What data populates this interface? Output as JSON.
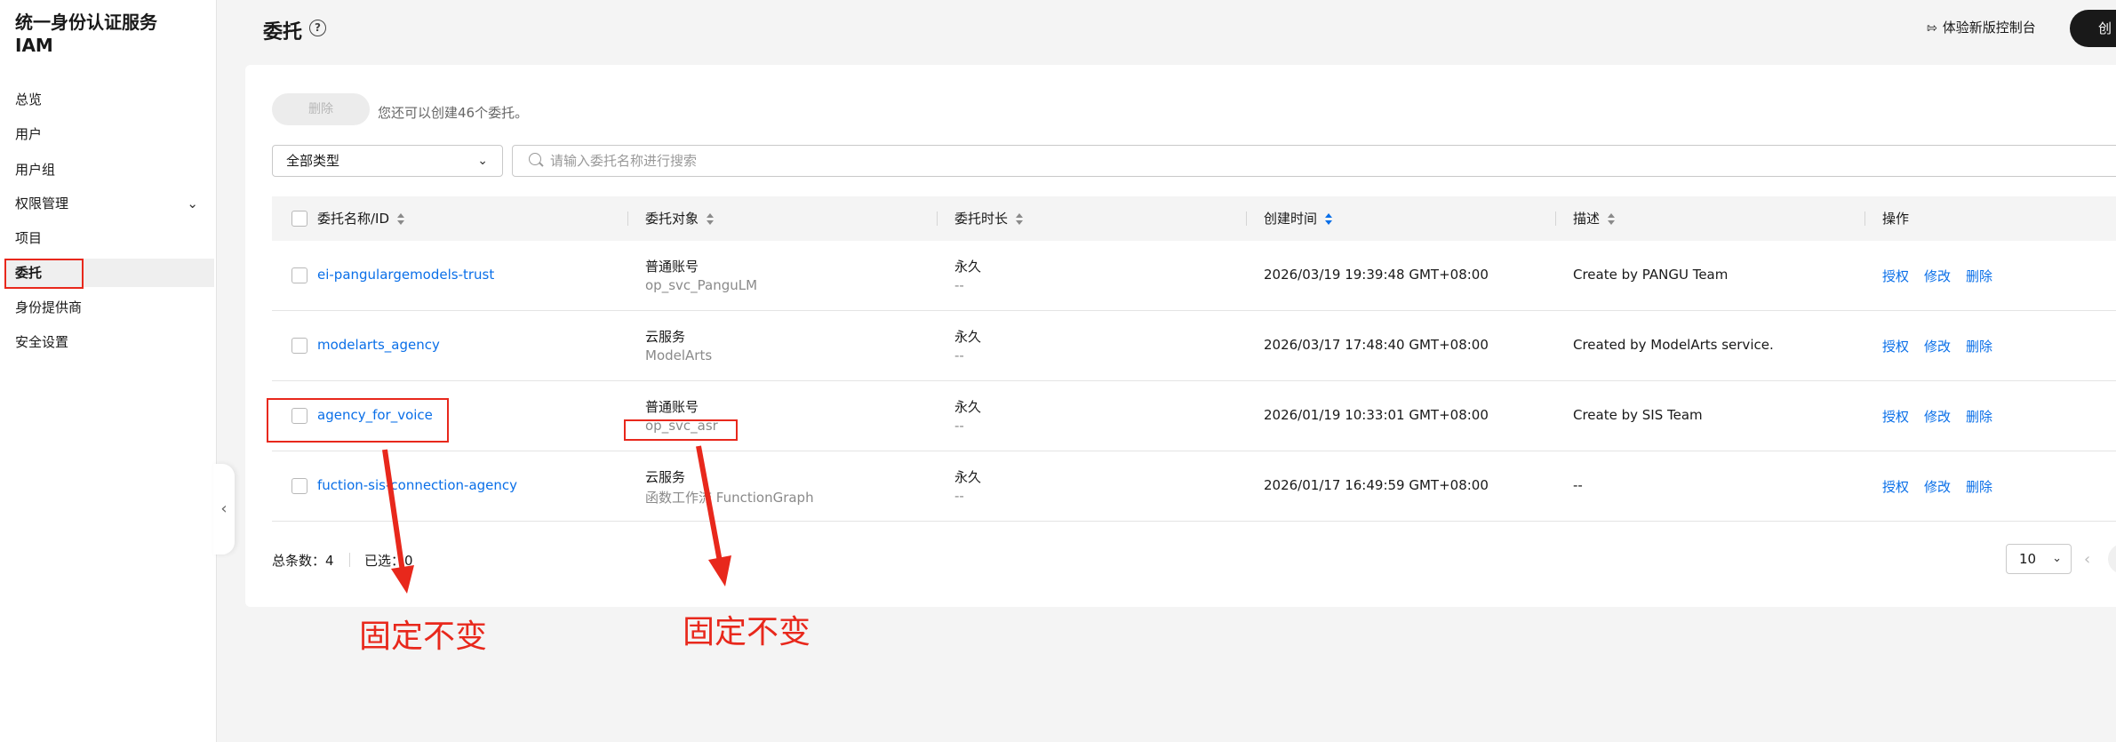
{
  "brand": {
    "title_line1": "统一身份认证服务",
    "title_line2": "IAM"
  },
  "sidebar": {
    "items": [
      {
        "label": "总览"
      },
      {
        "label": "用户"
      },
      {
        "label": "用户组"
      },
      {
        "label": "权限管理"
      },
      {
        "label": "项目"
      },
      {
        "label": "委托"
      },
      {
        "label": "身份提供商"
      },
      {
        "label": "安全设置"
      }
    ],
    "active": "委托"
  },
  "header": {
    "title": "委托",
    "help_icon": "?",
    "experience_console": "体验新版控制台",
    "create_button": "创"
  },
  "toolbar": {
    "delete_label": "删除",
    "quota_text": "您还可以创建46个委托。",
    "type_select_value": "全部类型",
    "search_placeholder": "请输入委托名称进行搜索"
  },
  "table": {
    "headers": {
      "name": "委托名称/ID",
      "target": "委托对象",
      "duration": "委托时长",
      "created": "创建时间",
      "description": "描述",
      "operations": "操作"
    },
    "rows": [
      {
        "name": "ei-pangulargemodels-trust",
        "target_type": "普通账号",
        "target_name": "op_svc_PanguLM",
        "duration": "永久",
        "duration_sub": "--",
        "created": "2026/03/19 19:39:48 GMT+08:00",
        "description": "Create by PANGU Team"
      },
      {
        "name": "modelarts_agency",
        "target_type": "云服务",
        "target_name": "ModelArts",
        "duration": "永久",
        "duration_sub": "--",
        "created": "2026/03/17 17:48:40 GMT+08:00",
        "description": "Created by ModelArts service."
      },
      {
        "name": "agency_for_voice",
        "target_type": "普通账号",
        "target_name": "op_svc_asr",
        "duration": "永久",
        "duration_sub": "--",
        "created": "2026/01/19 10:33:01 GMT+08:00",
        "description": "Create by SIS Team"
      },
      {
        "name": "fuction-sis-connection-agency",
        "target_type": "云服务",
        "target_name": "函数工作流 FunctionGraph",
        "duration": "永久",
        "duration_sub": "--",
        "created": "2026/01/17 16:49:59 GMT+08:00",
        "description": "--"
      }
    ],
    "operations": {
      "authorize": "授权",
      "modify": "修改",
      "delete": "删除"
    }
  },
  "pagination": {
    "total_label": "总条数：4",
    "selected_label": "已选：0",
    "page_size": "10"
  },
  "annotations": {
    "left_text": "固定不变",
    "right_text": "固定不变",
    "color": "#e8281c"
  },
  "colors": {
    "link": "#0a6fe8",
    "accent_dark": "#191919",
    "annotation": "#e8281c"
  }
}
